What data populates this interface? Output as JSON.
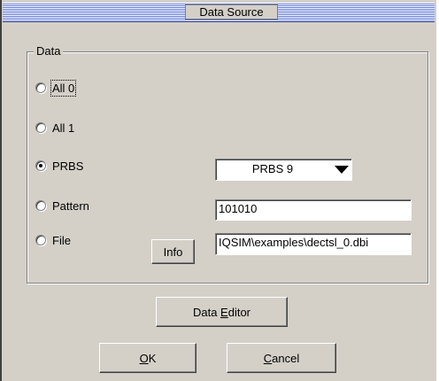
{
  "window": {
    "title": "Data Source"
  },
  "data_group": {
    "label": "Data",
    "options": [
      {
        "label": "All 0",
        "selected": false
      },
      {
        "label": "All 1",
        "selected": false
      },
      {
        "label": "PRBS",
        "selected": true
      },
      {
        "label": "Pattern",
        "selected": false
      },
      {
        "label": "File",
        "selected": false
      }
    ],
    "prbs_select_value": "PRBS 9",
    "pattern_value": "101010",
    "file_path_value": "IQSIM\\examples\\dectsl_0.dbi",
    "info_label": "Info"
  },
  "buttons": {
    "data_editor_pre": "Data ",
    "data_editor_mnemonic": "E",
    "data_editor_post": "ditor",
    "ok_mnemonic": "O",
    "ok_post": "K",
    "cancel_mnemonic": "C",
    "cancel_post": "ancel"
  }
}
